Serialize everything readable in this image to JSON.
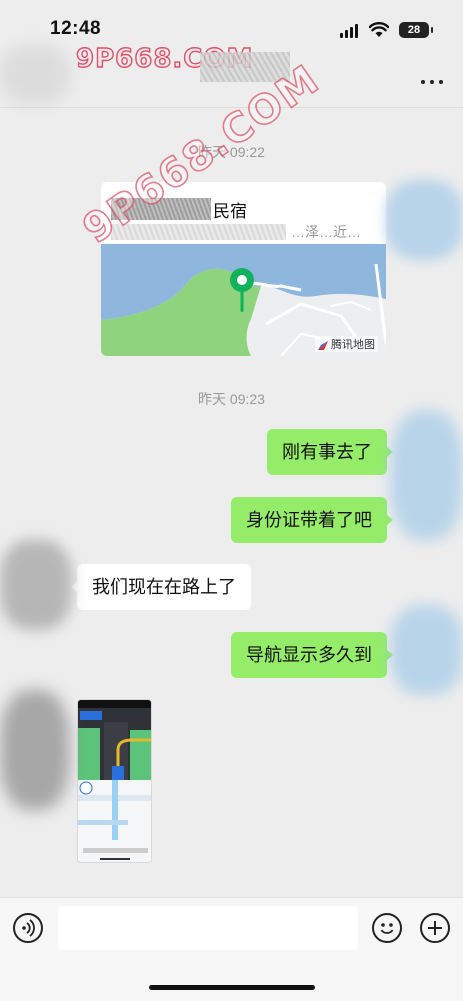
{
  "status_bar": {
    "time": "12:48",
    "battery": "28"
  },
  "header": {
    "watermark": "9P668.COM"
  },
  "watermark_diagonal": "9P668.COM",
  "chat": {
    "timestamp_1": "昨天 09:22",
    "location": {
      "title": "民宿",
      "address": "…泽…近…",
      "map_credit": "腾讯地图"
    },
    "timestamp_2": "昨天 09:23",
    "messages": [
      {
        "side": "sent",
        "text": "刚有事去了"
      },
      {
        "side": "sent",
        "text": "身份证带着了吧"
      },
      {
        "side": "received",
        "text": "我们现在在路上了"
      },
      {
        "side": "sent",
        "text": "导航显示多久到"
      }
    ],
    "image_message": {
      "kind": "navigation-screenshot"
    }
  },
  "input_bar": {
    "placeholder": ""
  },
  "colors": {
    "sent_bubble": "#95ec69",
    "received_bubble": "#ffffff",
    "background": "#ededed",
    "map_pin": "#12b25c"
  }
}
